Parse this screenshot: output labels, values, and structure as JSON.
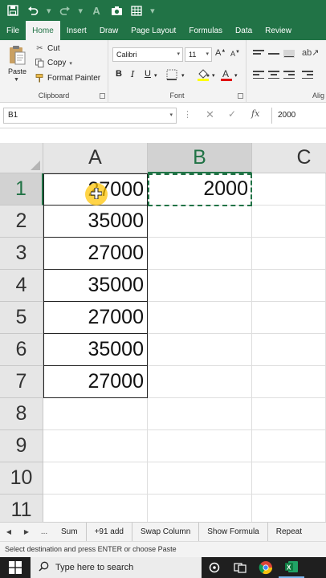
{
  "title_bar": {
    "autosave_icon": "save-icon",
    "undo_icon": "undo-icon",
    "camera_icon": "camera-icon",
    "table_icon": "table-icon"
  },
  "ribbon_tabs": [
    "File",
    "Home",
    "Insert",
    "Draw",
    "Page Layout",
    "Formulas",
    "Data",
    "Review"
  ],
  "active_tab": "Home",
  "clipboard": {
    "paste_label": "Paste",
    "cut_label": "Cut",
    "copy_label": "Copy",
    "format_painter_label": "Format Painter",
    "group_label": "Clipboard"
  },
  "font_group": {
    "font_name": "Calibri",
    "font_size": "11",
    "group_label": "Font",
    "bold": "B",
    "italic": "I",
    "underline": "U"
  },
  "alignment_group": {
    "group_label": "Alig"
  },
  "formula_bar": {
    "name_box": "B1",
    "formula_value": "2000",
    "fx_label": "fx"
  },
  "grid": {
    "columns": [
      "A",
      "B",
      "C"
    ],
    "selected_column": "B",
    "rows": [
      "1",
      "2",
      "3",
      "4",
      "5",
      "6",
      "7",
      "8",
      "9",
      "10",
      "11"
    ],
    "selected_row": "1",
    "column_a": [
      "27000",
      "35000",
      "27000",
      "35000",
      "27000",
      "35000",
      "27000"
    ],
    "b1": "2000"
  },
  "sheet_tabs": [
    "...",
    "Sum",
    "+91 add",
    "Swap Column",
    "Show Formula",
    "Repeat"
  ],
  "status_bar": {
    "message": "Select destination and press ENTER or choose Paste"
  },
  "taskbar": {
    "search_placeholder": "Type here to search"
  },
  "colors": {
    "excel_green": "#217346",
    "selection_marquee": "#217346",
    "cursor_highlight": "#FFC400"
  }
}
